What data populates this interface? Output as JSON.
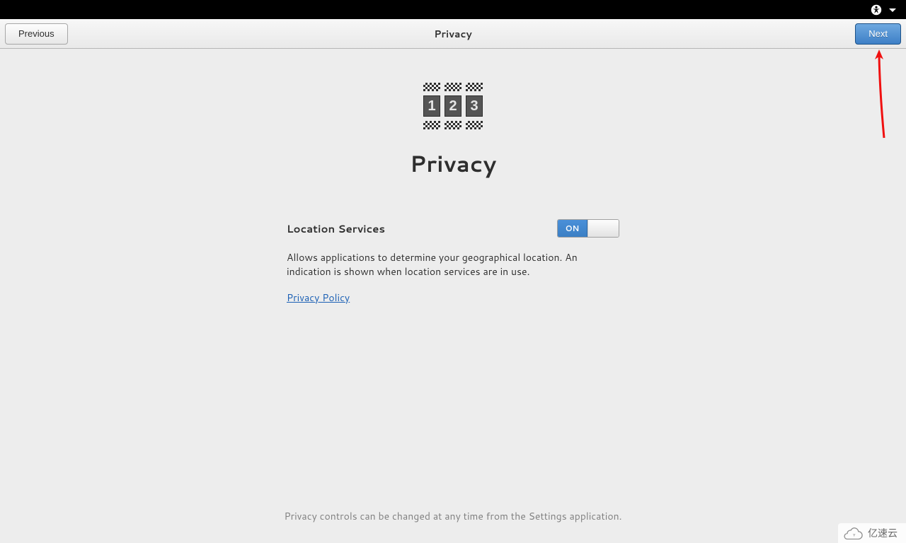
{
  "sysbar": {
    "a11y_icon": "accessibility-icon",
    "menu_icon": "chevron-down-icon"
  },
  "header": {
    "previous_label": "Previous",
    "title": "Privacy",
    "next_label": "Next"
  },
  "page": {
    "icon_digits": [
      "1",
      "2",
      "3"
    ],
    "title": "Privacy",
    "location": {
      "label": "Location Services",
      "switch_state": "ON",
      "description": "Allows applications to determine your geographical location. An indication is shown when location services are in use.",
      "policy_link": "Privacy Policy"
    },
    "footer": "Privacy controls can be changed at any time from the Settings application."
  },
  "watermark": "亿速云"
}
